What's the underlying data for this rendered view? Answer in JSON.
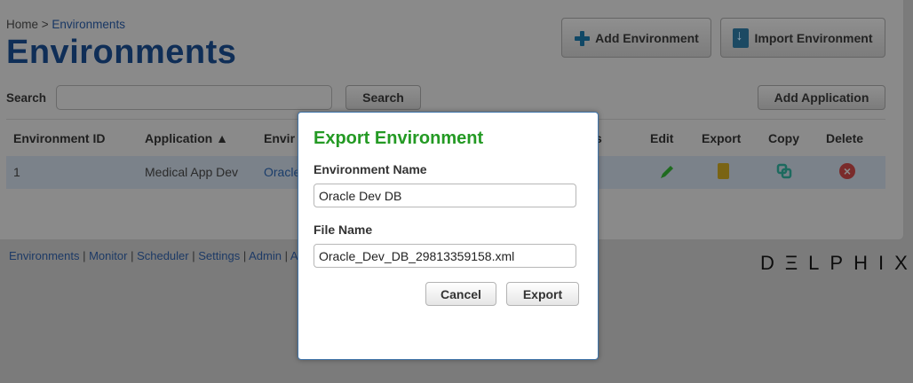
{
  "breadcrumb": {
    "home": "Home",
    "sep": " > ",
    "current": "Environments"
  },
  "page_title": "Environments",
  "top_buttons": {
    "add_environment": "Add Environment",
    "import_environment": "Import Environment"
  },
  "search": {
    "label": "Search",
    "value": "",
    "button": "Search"
  },
  "add_application": "Add Application",
  "table": {
    "headers": {
      "id": "Environment ID",
      "application": "Application ▲",
      "environment": "Envir",
      "status": "s",
      "edit": "Edit",
      "export": "Export",
      "copy": "Copy",
      "delete": "Delete"
    },
    "row": {
      "id": "1",
      "application": "Medical App Dev",
      "environment": "Oracle"
    }
  },
  "footer": {
    "environments": "Environments",
    "monitor": "Monitor",
    "scheduler": "Scheduler",
    "settings": "Settings",
    "admin": "Admin",
    "extra": "A",
    "brand": "DΞLPHIX"
  },
  "modal": {
    "title": "Export Environment",
    "env_name_label": "Environment Name",
    "env_name_value": "Oracle Dev DB",
    "file_name_label": "File Name",
    "file_name_value": "Oracle_Dev_DB_29813359158.xml",
    "cancel": "Cancel",
    "export": "Export"
  },
  "colors": {
    "accent_green": "#249a24",
    "title_blue": "#0f2e57",
    "modal_border": "#3f74a9"
  }
}
